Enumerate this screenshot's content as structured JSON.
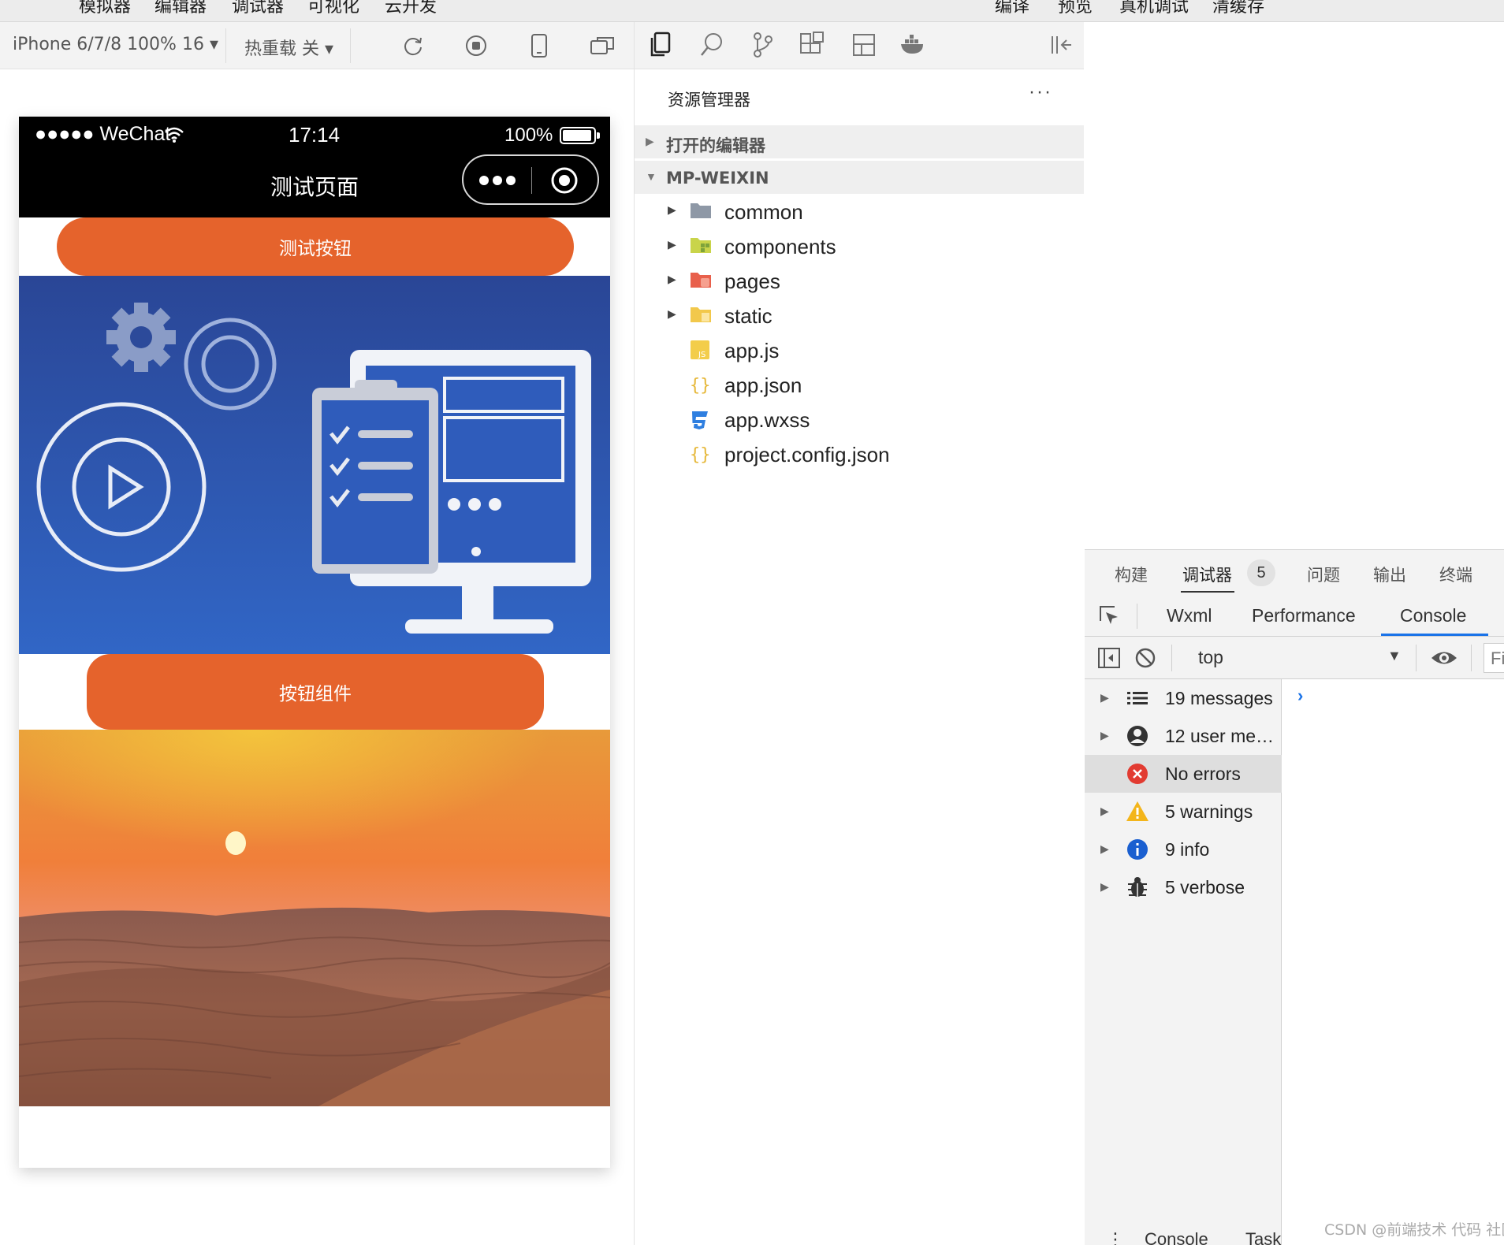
{
  "menubar": {
    "items_left": [
      "模拟器",
      "编辑器",
      "调试器",
      "可视化",
      "云开发"
    ],
    "items_right": [
      "编译",
      "预览",
      "真机调试",
      "清缓存"
    ]
  },
  "simulator_toolbar": {
    "device": "iPhone 6/7/8 100% 16",
    "hot_reload": "热重载 关"
  },
  "phone": {
    "carrier": "●●●●● WeChat",
    "time": "17:14",
    "battery": "100%",
    "nav_title": "测试页面",
    "button1": "测试按钮",
    "button2": "按钮组件",
    "colors": {
      "button": "#e5632c",
      "navbar": "#000000",
      "illustration_bg": "#2d4fa3",
      "sunset_top": "#f0b332"
    }
  },
  "explorer": {
    "title": "资源管理器",
    "more": "···",
    "section_open_editors": "打开的编辑器",
    "section_project": "MP-WEIXIN",
    "files": [
      {
        "name": "common",
        "type": "folder",
        "icon": "folder-gray-icon"
      },
      {
        "name": "components",
        "type": "folder",
        "icon": "folder-components-icon"
      },
      {
        "name": "pages",
        "type": "folder",
        "icon": "folder-pages-icon"
      },
      {
        "name": "static",
        "type": "folder",
        "icon": "folder-static-icon"
      },
      {
        "name": "app.js",
        "type": "file",
        "icon": "js-file-icon"
      },
      {
        "name": "app.json",
        "type": "file",
        "icon": "json-file-icon"
      },
      {
        "name": "app.wxss",
        "type": "file",
        "icon": "css-file-icon"
      },
      {
        "name": "project.config.json",
        "type": "file",
        "icon": "json-file-icon"
      }
    ]
  },
  "devtools": {
    "tabs": [
      "构建",
      "调试器",
      "问题",
      "输出",
      "终端"
    ],
    "badge": "5",
    "subtabs": [
      "Wxml",
      "Performance",
      "Console"
    ],
    "context": "top",
    "filter_stub": "Fi",
    "sidebar": [
      {
        "label": "19 messages",
        "icon": "list-icon"
      },
      {
        "label": "12 user me…",
        "icon": "user-icon"
      },
      {
        "label": "No errors",
        "icon": "error-icon"
      },
      {
        "label": "5 warnings",
        "icon": "warning-icon"
      },
      {
        "label": "9 info",
        "icon": "info-icon"
      },
      {
        "label": "5 verbose",
        "icon": "bug-icon"
      }
    ],
    "prompt": "›",
    "bottom_tabs": [
      "Console",
      "Task"
    ],
    "bottom_more": "⋮"
  },
  "watermark": "CSDN @前端技术 代码 社区"
}
